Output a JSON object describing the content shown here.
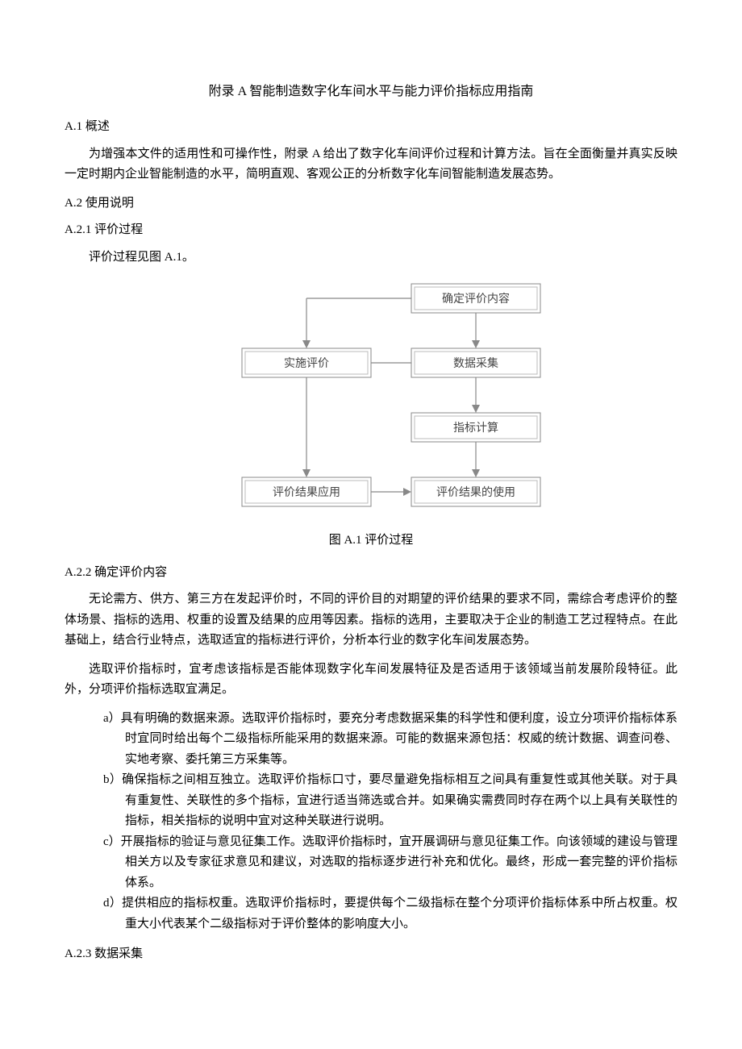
{
  "doc": {
    "title": "附录 A 智能制造数字化车间水平与能力评价指标应用指南",
    "sec": {
      "a1": {
        "h": "A.1 概述",
        "p1": "为增强本文件的适用性和可操作性，附录 A 给出了数字化车间评价过程和计算方法。旨在全面衡量并真实反映一定时期内企业智能制造的水平，简明直观、客观公正的分析数字化车间智能制造发展态势。"
      },
      "a2": {
        "h": "A.2 使用说明"
      },
      "a21": {
        "h": "A.2.1 评价过程",
        "p1": "评价过程见图 A.1。"
      },
      "fig": {
        "n1": "确定评价内容",
        "n2": "实施评价",
        "n3": "数据采集",
        "n4": "指标计算",
        "n5": "评价结果应用",
        "n6": "评价结果的使用",
        "cap": "图 A.1 评价过程"
      },
      "a22": {
        "h": "A.2.2 确定评价内容",
        "p1": "无论需方、供方、第三方在发起评价时，不同的评价目的对期望的评价结果的要求不同，需综合考虑评价的整体场景、指标的选用、权重的设置及结果的应用等因素。指标的选用，主要取决于企业的制造工艺过程特点。在此基础上，结合行业特点，选取适宜的指标进行评价，分析本行业的数字化车间发展态势。",
        "p2": "选取评价指标时，宜考虑该指标是否能体现数字化车间发展特征及是否适用于该领域当前发展阶段特征。此外，分项评价指标选取宜满足。",
        "li": {
          "a": "a）具有明确的数据来源。选取评价指标时，要充分考虑数据采集的科学性和便利度，设立分项评价指标体系时宜同时给出每个二级指标所能采用的数据来源。可能的数据来源包括：权威的统计数据、调查问卷、实地考察、委托第三方采集等。",
          "b": "b）确保指标之间相互独立。选取评价指标口寸，要尽量避免指标相互之间具有重复性或其他关联。对于具有重复性、关联性的多个指标，宜进行适当筛选或合并。如果确实需费同时存在两个以上具有关联性的指标，相关指标的说明中宜对这种关联进行说明。",
          "c": "c）开展指标的验证与意见征集工作。选取评价指标时，宜开展调研与意见征集工作。向该领域的建设与管理相关方以及专家征求意见和建议，对选取的指标逐步进行补充和优化。最终，形成一套完整的评价指标体系。",
          "d": "d）提供相应的指标权重。选取评价指标时，要提供每个二级指标在整个分项评价指标体系中所占权重。权重大小代表某个二级指标对于评价整体的影响度大小。"
        }
      },
      "a23": {
        "h": "A.2.3 数据采集"
      }
    }
  }
}
